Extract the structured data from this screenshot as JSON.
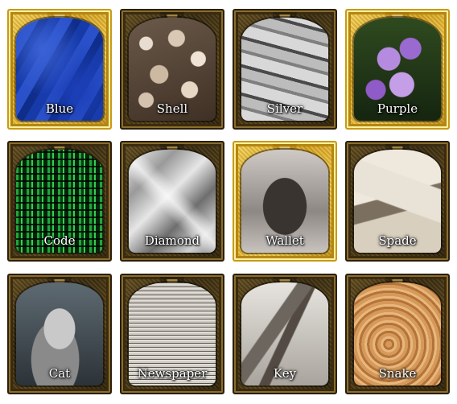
{
  "cards": [
    {
      "label": "Blue",
      "frame": "gold",
      "photo": "blue-fabric"
    },
    {
      "label": "Shell",
      "frame": "bronze",
      "photo": "shells"
    },
    {
      "label": "Silver",
      "frame": "bronze",
      "photo": "silver-bars"
    },
    {
      "label": "Purple",
      "frame": "gold",
      "photo": "purple-flowers"
    },
    {
      "label": "Code",
      "frame": "bronze",
      "photo": "green-code"
    },
    {
      "label": "Diamond",
      "frame": "bronze",
      "photo": "diamonds"
    },
    {
      "label": "Wallet",
      "frame": "gold",
      "photo": "wallet"
    },
    {
      "label": "Spade",
      "frame": "bronze",
      "photo": "playing-cards"
    },
    {
      "label": "Cat",
      "frame": "bronze",
      "photo": "cat"
    },
    {
      "label": "Newspaper",
      "frame": "bronze",
      "photo": "newspaper"
    },
    {
      "label": "Key",
      "frame": "bronze",
      "photo": "keys"
    },
    {
      "label": "Snake",
      "frame": "bronze",
      "photo": "snake"
    }
  ],
  "colors": {
    "gold_frame": "#d5a21f",
    "bronze_frame": "#3d2f12",
    "background": "#ffffff"
  }
}
